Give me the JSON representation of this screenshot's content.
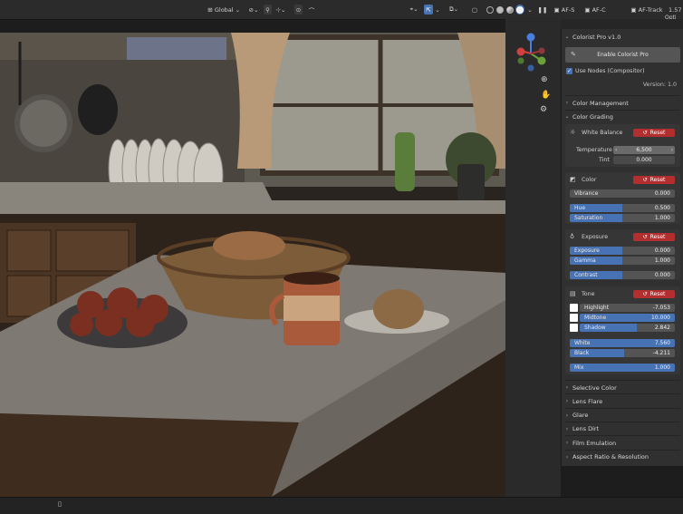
{
  "topbar": {
    "orientation": "Global",
    "af_s": "AF-S",
    "af_c": "AF-C",
    "af_track": "AF-Track",
    "version_cut": "1.57",
    "options_cut": "Opti"
  },
  "gizmo": {
    "z": "Z",
    "y": "Y",
    "x": "X"
  },
  "panel": {
    "title": "Colorist Pro v1.0",
    "enable_label": "Enable Colorist Pro",
    "use_nodes_label": "Use Nodes (Compositor)",
    "use_nodes_checked": true,
    "version": "Version: 1.0",
    "color_management": "Color Management",
    "color_grading": "Color Grading",
    "reset_label": "Reset",
    "white_balance": {
      "title": "White Balance",
      "temperature_label": "Temperature",
      "temperature_value": "6,500",
      "tint_label": "Tint",
      "tint_value": "0.000"
    },
    "color": {
      "title": "Color",
      "fields": [
        {
          "label": "Vibrance",
          "value": "0.000",
          "fill": 0.0
        },
        {
          "label": "Hue",
          "value": "0.500",
          "fill": 0.5
        },
        {
          "label": "Saturation",
          "value": "1.000",
          "fill": 0.5
        }
      ]
    },
    "exposure": {
      "title": "Exposure",
      "fields": [
        {
          "label": "Exposure",
          "value": "0.000",
          "fill": 0.5
        },
        {
          "label": "Gamma",
          "value": "1.000",
          "fill": 0.5
        },
        {
          "label": "Contrast",
          "value": "0.000",
          "fill": 0.5
        }
      ]
    },
    "tone": {
      "title": "Tone",
      "fields": [
        {
          "label": "Highlight",
          "value": "-7.053",
          "fill": 0.0
        },
        {
          "label": "Midtone",
          "value": "10.000",
          "fill": 1.0
        },
        {
          "label": "Shadow",
          "value": "2.842",
          "fill": 0.6
        },
        {
          "label": "White",
          "value": "7.560",
          "fill": 1.0
        },
        {
          "label": "Black",
          "value": "-4.211",
          "fill": 0.52
        },
        {
          "label": "Mix",
          "value": "1.000",
          "fill": 1.0
        }
      ]
    },
    "collapsed": [
      "Selective Color",
      "Lens Flare",
      "Glare",
      "Lens Dirt",
      "Film Emulation",
      "Aspect Ratio & Resolution"
    ]
  },
  "colors": {
    "accent": "#4772b3",
    "reset": "#b32f2f",
    "panel_bg": "#303030"
  }
}
